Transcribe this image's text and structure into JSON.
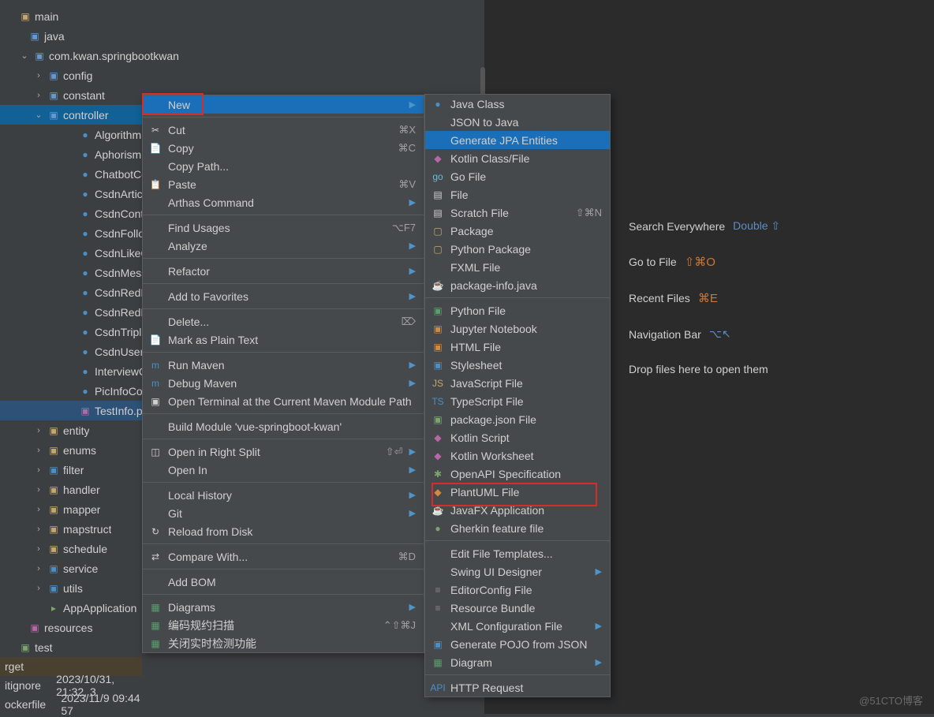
{
  "tree": {
    "root": "main",
    "java": "java",
    "package": "com.kwan.springbootkwan",
    "children": [
      {
        "name": "config",
        "type": "pkg",
        "exp": ">"
      },
      {
        "name": "constant",
        "type": "pkg",
        "exp": ">"
      },
      {
        "name": "controller",
        "type": "pkg",
        "exp": "v",
        "sel": true,
        "children": [
          "AlgorithmicP",
          "AphorismPo",
          "ChatbotCon",
          "CsdnArticle",
          "CsdnContro",
          "CsdnFollowI",
          "CsdnLikeCo",
          "CsdnMessa",
          "CsdnRedPa",
          "CsdnRedPa",
          "CsdnTripleI",
          "CsdnUserCo",
          "InterviewQu",
          "PicInfoCont"
        ],
        "file": "TestInfo.pur"
      },
      {
        "name": "entity",
        "type": "folder",
        "exp": ">"
      },
      {
        "name": "enums",
        "type": "folder",
        "exp": ">"
      },
      {
        "name": "filter",
        "type": "txt",
        "exp": ">"
      },
      {
        "name": "handler",
        "type": "folder",
        "exp": ">"
      },
      {
        "name": "mapper",
        "type": "folder",
        "exp": ">"
      },
      {
        "name": "mapstruct",
        "type": "folder",
        "exp": ">"
      },
      {
        "name": "schedule",
        "type": "folder",
        "exp": ">"
      },
      {
        "name": "service",
        "type": "txt",
        "exp": ">"
      },
      {
        "name": "utils",
        "type": "txt",
        "exp": ">"
      }
    ],
    "app": "AppApplication",
    "resources": "resources",
    "test": "test",
    "target": "rget",
    "gitignore_label": "itignore",
    "gitignore_date": "2023/10/31, 21:32, 3",
    "dockerfile_label": "ockerfile",
    "dockerfile_date": "2023/11/9  09:44  57"
  },
  "ctx1": [
    {
      "label": "New",
      "sel": true,
      "arrow": true
    },
    {
      "sep": true
    },
    {
      "label": "Cut",
      "icon": "✂",
      "short": "⌘X"
    },
    {
      "label": "Copy",
      "icon": "📄",
      "short": "⌘C",
      "iconColor": "#d28b3e"
    },
    {
      "label": "Copy Path..."
    },
    {
      "label": "Paste",
      "icon": "📋",
      "short": "⌘V",
      "iconColor": "#d28b3e"
    },
    {
      "label": "Arthas Command",
      "arrow": true
    },
    {
      "sep": true
    },
    {
      "label": "Find Usages",
      "short": "⌥F7"
    },
    {
      "label": "Analyze",
      "arrow": true
    },
    {
      "sep": true
    },
    {
      "label": "Refactor",
      "arrow": true
    },
    {
      "sep": true
    },
    {
      "label": "Add to Favorites",
      "arrow": true
    },
    {
      "sep": true
    },
    {
      "label": "Delete...",
      "short": "⌦"
    },
    {
      "label": "Mark as Plain Text",
      "icon": "📄"
    },
    {
      "sep": true
    },
    {
      "label": "Run Maven",
      "icon": "m",
      "iconColor": "#4a8fc7",
      "arrow": true
    },
    {
      "label": "Debug Maven",
      "icon": "m",
      "iconColor": "#4a8fc7",
      "arrow": true
    },
    {
      "label": "Open Terminal at the Current Maven Module Path",
      "icon": "▣"
    },
    {
      "sep": true
    },
    {
      "label": "Build Module 'vue-springboot-kwan'"
    },
    {
      "sep": true
    },
    {
      "label": "Open in Right Split",
      "icon": "◫",
      "short": "⇧⏎",
      "arrow": true
    },
    {
      "label": "Open In",
      "arrow": true
    },
    {
      "sep": true
    },
    {
      "label": "Local History",
      "arrow": true
    },
    {
      "label": "Git",
      "arrow": true
    },
    {
      "label": "Reload from Disk",
      "icon": "↻"
    },
    {
      "sep": true
    },
    {
      "label": "Compare With...",
      "icon": "⇄",
      "short": "⌘D"
    },
    {
      "sep": true
    },
    {
      "label": "Add BOM"
    },
    {
      "sep": true
    },
    {
      "label": "Diagrams",
      "icon": "▦",
      "iconColor": "#5a9e6f",
      "arrow": true
    },
    {
      "label": "编码规约扫描",
      "icon": "▦",
      "iconColor": "#5a9e6f",
      "short": "⌃⇧⌘J"
    },
    {
      "label": "关闭实时检测功能",
      "icon": "▦",
      "iconColor": "#5a9e6f"
    }
  ],
  "ctx2": [
    {
      "label": "Java Class",
      "icon": "●",
      "iconColor": "#4a8fc7"
    },
    {
      "label": "JSON to Java"
    },
    {
      "label": "Generate JPA Entities",
      "sel": true
    },
    {
      "label": "Kotlin Class/File",
      "icon": "◆",
      "iconColor": "#b767a8"
    },
    {
      "label": "Go File",
      "icon": "go",
      "iconColor": "#5ac0d8"
    },
    {
      "label": "File",
      "icon": "▤"
    },
    {
      "label": "Scratch File",
      "icon": "▤",
      "short": "⇧⌘N"
    },
    {
      "label": "Package",
      "icon": "▢",
      "iconColor": "#c5a76d"
    },
    {
      "label": "Python Package",
      "icon": "▢",
      "iconColor": "#c5a76d"
    },
    {
      "label": "FXML File",
      "icon": "</>",
      "iconColor": "#b767a8"
    },
    {
      "label": "package-info.java",
      "icon": "☕",
      "iconColor": "#d28b3e"
    },
    {
      "sep": true
    },
    {
      "label": "Python File",
      "icon": "▣",
      "iconColor": "#5a9e6f"
    },
    {
      "label": "Jupyter Notebook",
      "icon": "▣",
      "iconColor": "#d28b3e"
    },
    {
      "label": "HTML File",
      "icon": "▣",
      "iconColor": "#d28b3e"
    },
    {
      "label": "Stylesheet",
      "icon": "▣",
      "iconColor": "#4a8fc7"
    },
    {
      "label": "JavaScript File",
      "icon": "JS",
      "iconColor": "#c5a76d"
    },
    {
      "label": "TypeScript File",
      "icon": "TS",
      "iconColor": "#4a8fc7"
    },
    {
      "label": "package.json File",
      "icon": "▣",
      "iconColor": "#7aa66d"
    },
    {
      "label": "Kotlin Script",
      "icon": "◆",
      "iconColor": "#b767a8"
    },
    {
      "label": "Kotlin Worksheet",
      "icon": "◆",
      "iconColor": "#b767a8"
    },
    {
      "label": "OpenAPI Specification",
      "icon": "✱",
      "iconColor": "#7aa66d"
    },
    {
      "label": "PlantUML File",
      "icon": "◆",
      "iconColor": "#d28b3e",
      "box": true
    },
    {
      "label": "JavaFX Application",
      "icon": "☕",
      "iconColor": "#d28b3e"
    },
    {
      "label": "Gherkin feature file",
      "icon": "●",
      "iconColor": "#7aa66d"
    },
    {
      "sep": true
    },
    {
      "label": "Edit File Templates..."
    },
    {
      "label": "Swing UI Designer",
      "arrow": true
    },
    {
      "label": "EditorConfig File",
      "icon": "≡",
      "iconColor": "#888"
    },
    {
      "label": "Resource Bundle",
      "icon": "≡",
      "iconColor": "#888"
    },
    {
      "label": "XML Configuration File",
      "icon": "</>",
      "iconColor": "#b767a8",
      "arrow": true
    },
    {
      "label": "Generate POJO from JSON",
      "icon": "▣",
      "iconColor": "#4a8fc7"
    },
    {
      "label": "Diagram",
      "icon": "▦",
      "iconColor": "#5a9e6f",
      "arrow": true
    },
    {
      "sep": true
    },
    {
      "label": "HTTP Request",
      "icon": "API",
      "iconColor": "#4a8fc7"
    }
  ],
  "hints": {
    "search_label": "Search Everywhere",
    "search_key": "Double ⇧",
    "goto_label": "Go to File",
    "goto_key": "⇧⌘O",
    "recent_label": "Recent Files",
    "recent_key": "⌘E",
    "nav_label": "Navigation Bar",
    "nav_key": "⌥↖",
    "drop": "Drop files here to open them"
  },
  "watermark": "@51CTO博客"
}
